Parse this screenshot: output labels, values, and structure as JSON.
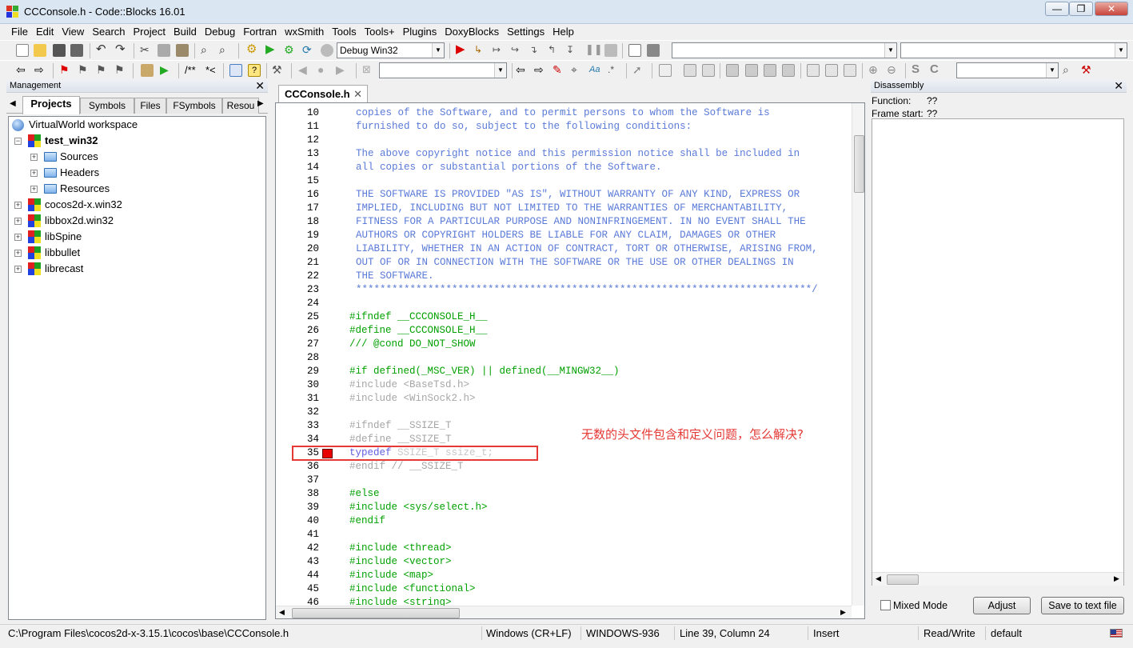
{
  "window": {
    "title": "CCConsole.h - Code::Blocks 16.01",
    "min": "—",
    "max": "❐",
    "close": "✕"
  },
  "menu": [
    "File",
    "Edit",
    "View",
    "Search",
    "Project",
    "Build",
    "Debug",
    "Fortran",
    "wxSmith",
    "Tools",
    "Tools+",
    "Plugins",
    "DoxyBlocks",
    "Settings",
    "Help"
  ],
  "toolbar": {
    "build_target": "Debug Win32",
    "doxy_comment": "/**",
    "doxy_line": "*<"
  },
  "management": {
    "title": "Management",
    "tabs": [
      "Projects",
      "Symbols",
      "Files",
      "FSymbols",
      "Resou"
    ],
    "tree": [
      {
        "label": "VirtualWorld workspace",
        "kind": "workspace"
      },
      {
        "label": "test_win32",
        "kind": "project",
        "bold": true,
        "expanded": true
      },
      {
        "label": "Sources",
        "kind": "folder"
      },
      {
        "label": "Headers",
        "kind": "folder"
      },
      {
        "label": "Resources",
        "kind": "folder"
      },
      {
        "label": "cocos2d-x.win32",
        "kind": "project"
      },
      {
        "label": "libbox2d.win32",
        "kind": "project"
      },
      {
        "label": "libSpine",
        "kind": "project"
      },
      {
        "label": "libbullet",
        "kind": "project"
      },
      {
        "label": "librecast",
        "kind": "project"
      }
    ]
  },
  "editor": {
    "tab_label": "CCConsole.h",
    "lines": [
      {
        "n": "10",
        "t": "copies of the Software, and to permit persons to whom the Software is",
        "c": "cmt",
        "i": 1
      },
      {
        "n": "11",
        "t": "furnished to do so, subject to the following conditions:",
        "c": "cmt",
        "i": 1
      },
      {
        "n": "12",
        "t": "",
        "c": "cmt",
        "i": 1
      },
      {
        "n": "13",
        "t": "The above copyright notice and this permission notice shall be included in",
        "c": "cmt",
        "i": 1
      },
      {
        "n": "14",
        "t": "all copies or substantial portions of the Software.",
        "c": "cmt",
        "i": 1
      },
      {
        "n": "15",
        "t": "",
        "c": "cmt",
        "i": 1
      },
      {
        "n": "16",
        "t": "THE SOFTWARE IS PROVIDED \"AS IS\", WITHOUT WARRANTY OF ANY KIND, EXPRESS OR",
        "c": "cmt",
        "i": 1
      },
      {
        "n": "17",
        "t": "IMPLIED, INCLUDING BUT NOT LIMITED TO THE WARRANTIES OF MERCHANTABILITY,",
        "c": "cmt",
        "i": 1
      },
      {
        "n": "18",
        "t": "FITNESS FOR A PARTICULAR PURPOSE AND NONINFRINGEMENT. IN NO EVENT SHALL THE",
        "c": "cmt",
        "i": 1
      },
      {
        "n": "19",
        "t": "AUTHORS OR COPYRIGHT HOLDERS BE LIABLE FOR ANY CLAIM, DAMAGES OR OTHER",
        "c": "cmt",
        "i": 1
      },
      {
        "n": "20",
        "t": "LIABILITY, WHETHER IN AN ACTION OF CONTRACT, TORT OR OTHERWISE, ARISING FROM,",
        "c": "cmt",
        "i": 1
      },
      {
        "n": "21",
        "t": "OUT OF OR IN CONNECTION WITH THE SOFTWARE OR THE USE OR OTHER DEALINGS IN",
        "c": "cmt",
        "i": 1
      },
      {
        "n": "22",
        "t": "THE SOFTWARE.",
        "c": "cmt",
        "i": 1
      },
      {
        "n": "23",
        "t": "****************************************************************************/",
        "c": "cmt",
        "i": 1
      },
      {
        "n": "24",
        "t": "",
        "c": "pp",
        "i": 0
      },
      {
        "n": "25",
        "t": "#ifndef __CCCONSOLE_H__",
        "c": "pp",
        "i": 0
      },
      {
        "n": "26",
        "t": "#define __CCCONSOLE_H__",
        "c": "pp",
        "i": 0
      },
      {
        "n": "27",
        "t": "/// @cond DO_NOT_SHOW",
        "c": "pp",
        "i": 0
      },
      {
        "n": "28",
        "t": "",
        "c": "pp",
        "i": 0
      },
      {
        "n": "29",
        "t": "#if defined(_MSC_VER) || defined(__MINGW32__)",
        "c": "pp",
        "i": 0
      },
      {
        "n": "30",
        "t": "#include <BaseTsd.h>",
        "c": "pp-dim",
        "i": 0
      },
      {
        "n": "31",
        "t": "#include <WinSock2.h>",
        "c": "pp-dim",
        "i": 0
      },
      {
        "n": "32",
        "t": "",
        "c": "pp-dim",
        "i": 0
      },
      {
        "n": "33",
        "t": "#ifndef __SSIZE_T",
        "c": "pp-dim",
        "i": 0
      },
      {
        "n": "34",
        "t": "#define __SSIZE_T",
        "c": "pp-dim",
        "i": 0
      },
      {
        "n": "35",
        "t": "typedef SSIZE_T ssize_t;",
        "c": "typedef",
        "i": 0
      },
      {
        "n": "36",
        "t": "#endif // __SSIZE_T",
        "c": "pp-dim",
        "i": 0
      },
      {
        "n": "37",
        "t": "",
        "c": "pp",
        "i": 0
      },
      {
        "n": "38",
        "t": "#else",
        "c": "pp",
        "i": 0
      },
      {
        "n": "39",
        "t": "#include <sys/select.h>",
        "c": "pp",
        "i": 0
      },
      {
        "n": "40",
        "t": "#endif",
        "c": "pp",
        "i": 0
      },
      {
        "n": "41",
        "t": "",
        "c": "pp",
        "i": 0
      },
      {
        "n": "42",
        "t": "#include <thread>",
        "c": "pp",
        "i": 0
      },
      {
        "n": "43",
        "t": "#include <vector>",
        "c": "pp",
        "i": 0
      },
      {
        "n": "44",
        "t": "#include <map>",
        "c": "pp",
        "i": 0
      },
      {
        "n": "45",
        "t": "#include <functional>",
        "c": "pp",
        "i": 0
      },
      {
        "n": "46",
        "t": "#include <string>",
        "c": "pp",
        "i": 0
      }
    ],
    "annotation": "无数的头文件包含和定义问题，怎么解决?"
  },
  "disassembly": {
    "title": "Disassembly",
    "function_label": "Function:",
    "function_value": "??",
    "frame_label": "Frame start:",
    "frame_value": "??",
    "mixed_mode": "Mixed Mode",
    "adjust": "Adjust",
    "save": "Save to text file"
  },
  "statusbar": {
    "path": "C:\\Program Files\\cocos2d-x-3.15.1\\cocos\\base\\CCConsole.h",
    "eol": "Windows (CR+LF)",
    "encoding": "WINDOWS-936",
    "position": "Line 39, Column 24",
    "mode": "Insert",
    "access": "Read/Write",
    "profile": "default"
  },
  "colors": {
    "comment": "#5a7ad8",
    "preprocessor": "#00a000",
    "inactive": "#a6a6a6",
    "keyword": "#6060e0",
    "annotation": "#e53935"
  }
}
